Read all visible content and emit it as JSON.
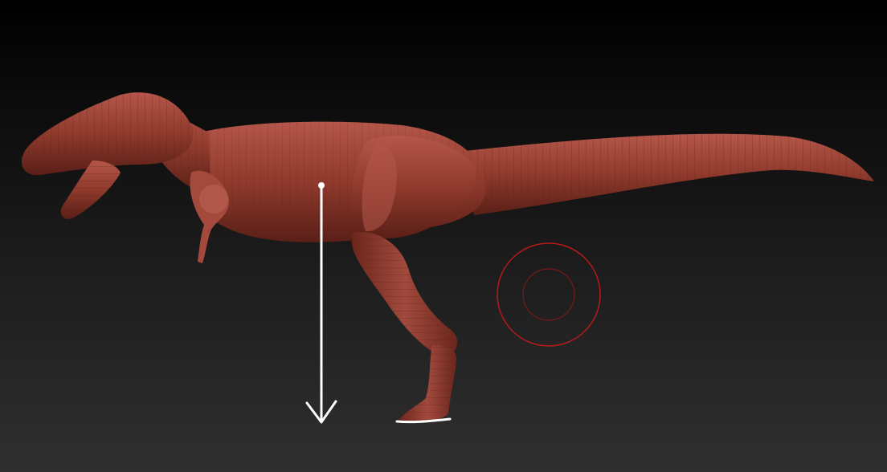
{
  "viewport": {
    "type": "3d-sculpt-canvas",
    "background_top": "#000000",
    "background_bottom": "#2f2f2f"
  },
  "model": {
    "subject": "theropod-dinosaur-sculpt",
    "material_color": "#8f3a2c",
    "highlight_color": "#b5574a",
    "shadow_color": "#5a1f17"
  },
  "annotations": {
    "arrow_color": "#ffffff",
    "arrow_direction": "down",
    "ground_mark_color": "#ffffff"
  },
  "brush_cursor": {
    "outer_ring_color": "#b31b1b",
    "inner_ring_color": "#7a1a1a"
  }
}
